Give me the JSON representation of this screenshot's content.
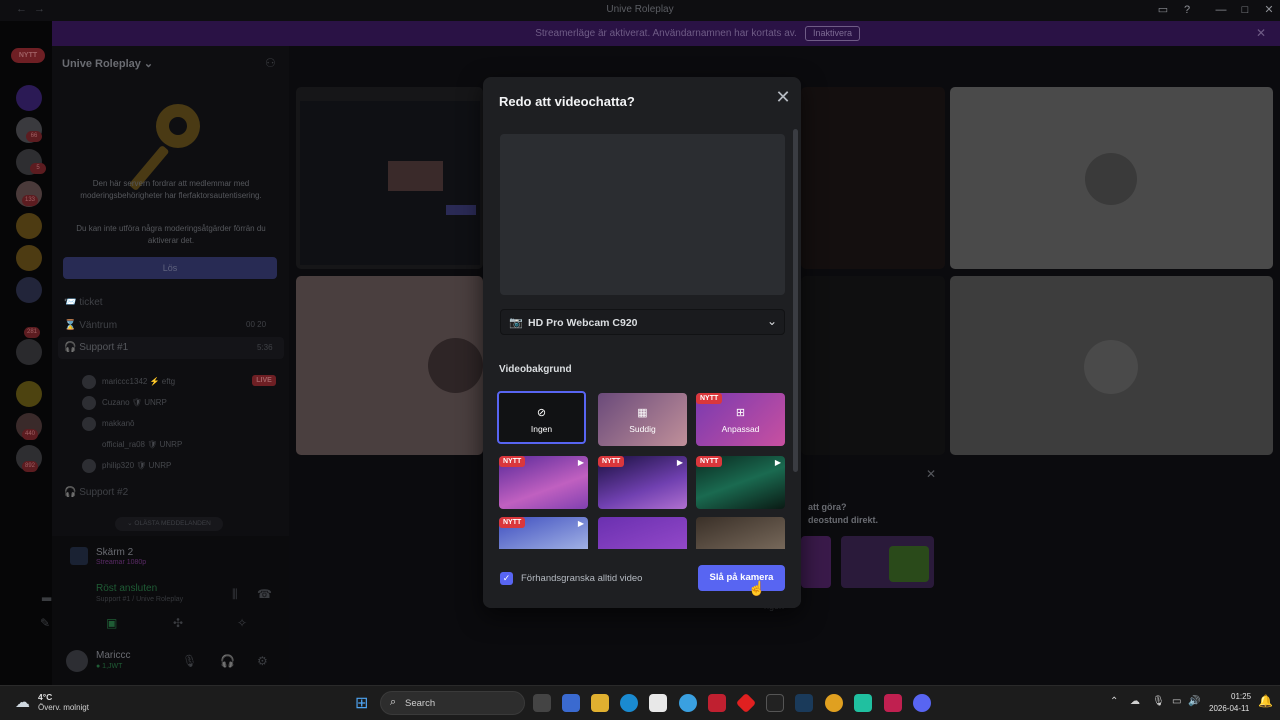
{
  "window": {
    "title": "Unive Roleplay",
    "back": "←",
    "forward": "→"
  },
  "banner": {
    "text": "Streamerläge är aktiverat. Användarnamnen har kortats av.",
    "button": "Inaktivera"
  },
  "rail": {
    "nytt_label": "NYTT",
    "badges": [
      "66",
      "5",
      "133",
      "281",
      "440",
      "892"
    ]
  },
  "sidebar": {
    "server_name": "Unive Roleplay",
    "mod_text_1": "Den här servern fordrar att medlemmar med moderingsbehörigheter har flerfaktorsautentisering.",
    "mod_text_2": "Du kan inte utföra några moderingsåtgärder förrän du aktiverar det.",
    "los_button": "Lös",
    "channels": [
      {
        "label": "📨 ticket"
      },
      {
        "label": "⌛ Väntrum",
        "counts": "00  20"
      },
      {
        "label": "🎧 Support #1",
        "time": "5:36"
      },
      {
        "label": "🎧 Support #2"
      }
    ],
    "members": [
      {
        "name": "mariccc1342",
        "tag": "⚡ eftg"
      },
      {
        "name": "Cuzano",
        "tag": "🛡 UNRP"
      },
      {
        "name": "makkanô",
        "tag": ""
      },
      {
        "name": "official_ra08",
        "tag": "🛡 UNRP"
      },
      {
        "name": "philip320",
        "tag": "🛡 UNRP"
      }
    ],
    "live_label": "LIVE",
    "unread_pill": "⌄ OLÄSTA MEDDELANDEN",
    "screen": {
      "title": "Skärm 2",
      "sub": "Streamar 1080p"
    },
    "voice": {
      "status": "Röst ansluten",
      "channel": "Support #1 / Unive Roleplay"
    },
    "user": {
      "name": "Mariccc",
      "status": "● 1,JWT"
    }
  },
  "modal": {
    "title": "Redo att videochatta?",
    "camera": "HD Pro Webcam C920",
    "background_label": "Videobakgrund",
    "options": [
      {
        "label": "Ingen",
        "icon": "⊘",
        "nytt": false,
        "selected": true
      },
      {
        "label": "Suddig",
        "icon": "▦",
        "nytt": false,
        "selected": false
      },
      {
        "label": "Anpassad",
        "icon": "⊞",
        "nytt": true,
        "selected": false
      }
    ],
    "nytt_label": "NYTT",
    "preview_checkbox": "Förhandsgranska alltid video",
    "primary_button": "Slå på kamera"
  },
  "background_promo": {
    "line1": "att göra?",
    "line2": "deostund direkt.",
    "misc": "ngen"
  },
  "taskbar": {
    "temperature": "4°C",
    "weather": "Överv. molnigt",
    "search": "Search",
    "time": "01:25",
    "date": "2026-04-11"
  },
  "colors": {
    "accent": "#5865f2",
    "danger": "#da373c",
    "modal_bg": "#1e1f22"
  }
}
